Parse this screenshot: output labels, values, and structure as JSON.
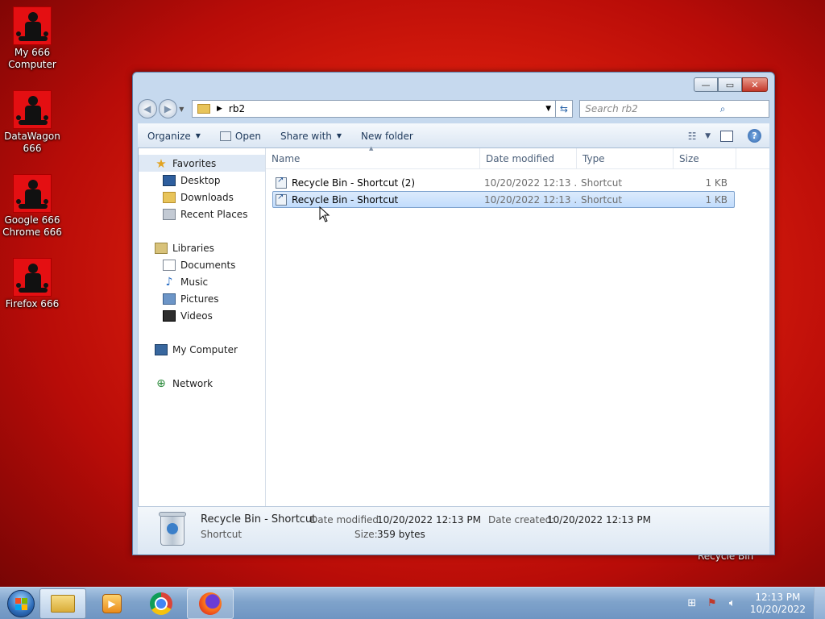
{
  "desktop": {
    "icons": [
      {
        "label": "My 666 Computer"
      },
      {
        "label": "DataWagon 666"
      },
      {
        "label": "Google 666 Chrome 666"
      },
      {
        "label": "Firefox 666"
      }
    ],
    "recycle_bin_label": "Recycle Bin"
  },
  "window": {
    "caption": {
      "minimize": "—",
      "maximize": "▭",
      "close": "✕"
    },
    "address": {
      "crumb": "rb2"
    },
    "search": {
      "placeholder": "Search rb2"
    },
    "toolbar": {
      "organize": "Organize",
      "open": "Open",
      "share_with": "Share with",
      "new_folder": "New folder",
      "help": "?"
    },
    "nav": {
      "favorites": "Favorites",
      "desktop": "Desktop",
      "downloads": "Downloads",
      "recent_places": "Recent Places",
      "libraries": "Libraries",
      "documents": "Documents",
      "music": "Music",
      "pictures": "Pictures",
      "videos": "Videos",
      "my_computer": "My Computer",
      "network": "Network"
    },
    "columns": {
      "name": "Name",
      "date": "Date modified",
      "type": "Type",
      "size": "Size"
    },
    "files": [
      {
        "name": "Recycle Bin - Shortcut (2)",
        "date": "10/20/2022 12:13 ...",
        "type": "Shortcut",
        "size": "1 KB",
        "selected": false
      },
      {
        "name": "Recycle Bin - Shortcut",
        "date": "10/20/2022 12:13 ...",
        "type": "Shortcut",
        "size": "1 KB",
        "selected": true
      }
    ],
    "details": {
      "name": "Recycle Bin - Shortcut",
      "type": "Shortcut",
      "date_modified_label": "Date modified:",
      "date_modified": "10/20/2022 12:13 PM",
      "date_created_label": "Date created:",
      "date_created": "10/20/2022 12:13 PM",
      "size_label": "Size:",
      "size": "359 bytes"
    }
  },
  "taskbar": {
    "clock_time": "12:13 PM",
    "clock_date": "10/20/2022"
  },
  "colors": {
    "desktop_red": "#d41a0c",
    "selection": "#c1dcfc",
    "window_frame": "#c6d9ee"
  }
}
